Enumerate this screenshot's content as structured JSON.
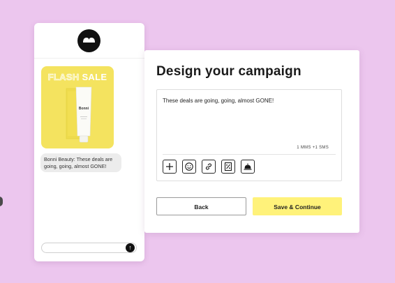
{
  "phone_preview": {
    "promo_word_1": "FLASH",
    "promo_word_2": "SALE",
    "product_brand": "Bonni",
    "message_bubble": "Bonni Beauty: These deals are going, going, almost GONE!",
    "send_icon": "↑"
  },
  "campaign": {
    "title": "Design your campaign",
    "message_text": "These deals are going, going, almost GONE!",
    "sms_count": "1 MMS +1 SMS",
    "tools": [
      "add-icon",
      "emoji-icon",
      "link-icon",
      "discount-icon",
      "concierge-bell-icon"
    ]
  },
  "buttons": {
    "back": "Back",
    "save_continue": "Save & Continue"
  },
  "colors": {
    "page_background": "#ecc6ee",
    "accent_yellow": "#fff27a",
    "image_yellow": "#f4e35f"
  }
}
